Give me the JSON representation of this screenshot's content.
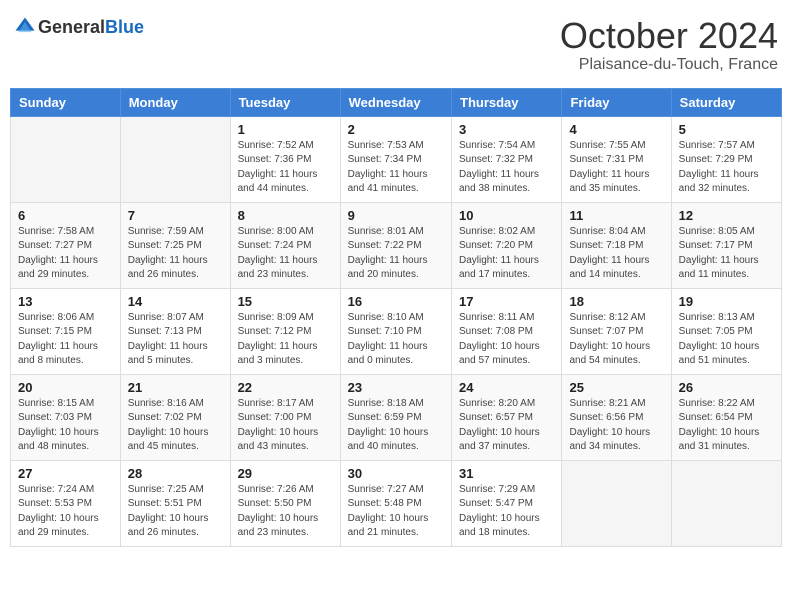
{
  "header": {
    "logo_general": "General",
    "logo_blue": "Blue",
    "month": "October 2024",
    "location": "Plaisance-du-Touch, France"
  },
  "weekdays": [
    "Sunday",
    "Monday",
    "Tuesday",
    "Wednesday",
    "Thursday",
    "Friday",
    "Saturday"
  ],
  "weeks": [
    [
      {
        "day": "",
        "info": ""
      },
      {
        "day": "",
        "info": ""
      },
      {
        "day": "1",
        "info": "Sunrise: 7:52 AM\nSunset: 7:36 PM\nDaylight: 11 hours and 44 minutes."
      },
      {
        "day": "2",
        "info": "Sunrise: 7:53 AM\nSunset: 7:34 PM\nDaylight: 11 hours and 41 minutes."
      },
      {
        "day": "3",
        "info": "Sunrise: 7:54 AM\nSunset: 7:32 PM\nDaylight: 11 hours and 38 minutes."
      },
      {
        "day": "4",
        "info": "Sunrise: 7:55 AM\nSunset: 7:31 PM\nDaylight: 11 hours and 35 minutes."
      },
      {
        "day": "5",
        "info": "Sunrise: 7:57 AM\nSunset: 7:29 PM\nDaylight: 11 hours and 32 minutes."
      }
    ],
    [
      {
        "day": "6",
        "info": "Sunrise: 7:58 AM\nSunset: 7:27 PM\nDaylight: 11 hours and 29 minutes."
      },
      {
        "day": "7",
        "info": "Sunrise: 7:59 AM\nSunset: 7:25 PM\nDaylight: 11 hours and 26 minutes."
      },
      {
        "day": "8",
        "info": "Sunrise: 8:00 AM\nSunset: 7:24 PM\nDaylight: 11 hours and 23 minutes."
      },
      {
        "day": "9",
        "info": "Sunrise: 8:01 AM\nSunset: 7:22 PM\nDaylight: 11 hours and 20 minutes."
      },
      {
        "day": "10",
        "info": "Sunrise: 8:02 AM\nSunset: 7:20 PM\nDaylight: 11 hours and 17 minutes."
      },
      {
        "day": "11",
        "info": "Sunrise: 8:04 AM\nSunset: 7:18 PM\nDaylight: 11 hours and 14 minutes."
      },
      {
        "day": "12",
        "info": "Sunrise: 8:05 AM\nSunset: 7:17 PM\nDaylight: 11 hours and 11 minutes."
      }
    ],
    [
      {
        "day": "13",
        "info": "Sunrise: 8:06 AM\nSunset: 7:15 PM\nDaylight: 11 hours and 8 minutes."
      },
      {
        "day": "14",
        "info": "Sunrise: 8:07 AM\nSunset: 7:13 PM\nDaylight: 11 hours and 5 minutes."
      },
      {
        "day": "15",
        "info": "Sunrise: 8:09 AM\nSunset: 7:12 PM\nDaylight: 11 hours and 3 minutes."
      },
      {
        "day": "16",
        "info": "Sunrise: 8:10 AM\nSunset: 7:10 PM\nDaylight: 11 hours and 0 minutes."
      },
      {
        "day": "17",
        "info": "Sunrise: 8:11 AM\nSunset: 7:08 PM\nDaylight: 10 hours and 57 minutes."
      },
      {
        "day": "18",
        "info": "Sunrise: 8:12 AM\nSunset: 7:07 PM\nDaylight: 10 hours and 54 minutes."
      },
      {
        "day": "19",
        "info": "Sunrise: 8:13 AM\nSunset: 7:05 PM\nDaylight: 10 hours and 51 minutes."
      }
    ],
    [
      {
        "day": "20",
        "info": "Sunrise: 8:15 AM\nSunset: 7:03 PM\nDaylight: 10 hours and 48 minutes."
      },
      {
        "day": "21",
        "info": "Sunrise: 8:16 AM\nSunset: 7:02 PM\nDaylight: 10 hours and 45 minutes."
      },
      {
        "day": "22",
        "info": "Sunrise: 8:17 AM\nSunset: 7:00 PM\nDaylight: 10 hours and 43 minutes."
      },
      {
        "day": "23",
        "info": "Sunrise: 8:18 AM\nSunset: 6:59 PM\nDaylight: 10 hours and 40 minutes."
      },
      {
        "day": "24",
        "info": "Sunrise: 8:20 AM\nSunset: 6:57 PM\nDaylight: 10 hours and 37 minutes."
      },
      {
        "day": "25",
        "info": "Sunrise: 8:21 AM\nSunset: 6:56 PM\nDaylight: 10 hours and 34 minutes."
      },
      {
        "day": "26",
        "info": "Sunrise: 8:22 AM\nSunset: 6:54 PM\nDaylight: 10 hours and 31 minutes."
      }
    ],
    [
      {
        "day": "27",
        "info": "Sunrise: 7:24 AM\nSunset: 5:53 PM\nDaylight: 10 hours and 29 minutes."
      },
      {
        "day": "28",
        "info": "Sunrise: 7:25 AM\nSunset: 5:51 PM\nDaylight: 10 hours and 26 minutes."
      },
      {
        "day": "29",
        "info": "Sunrise: 7:26 AM\nSunset: 5:50 PM\nDaylight: 10 hours and 23 minutes."
      },
      {
        "day": "30",
        "info": "Sunrise: 7:27 AM\nSunset: 5:48 PM\nDaylight: 10 hours and 21 minutes."
      },
      {
        "day": "31",
        "info": "Sunrise: 7:29 AM\nSunset: 5:47 PM\nDaylight: 10 hours and 18 minutes."
      },
      {
        "day": "",
        "info": ""
      },
      {
        "day": "",
        "info": ""
      }
    ]
  ]
}
